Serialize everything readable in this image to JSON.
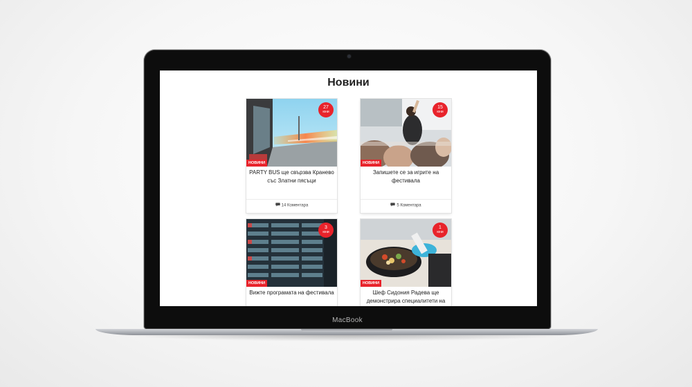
{
  "device": {
    "brand": "MacBook"
  },
  "page": {
    "title": "Новини"
  },
  "news": [
    {
      "day": "27",
      "month": "юни",
      "category": "НОВИНИ",
      "title": "PARTY BUS ще свързва Кранево със Златни пясъци",
      "comments": "14 Коментара"
    },
    {
      "day": "15",
      "month": "юни",
      "category": "НОВИНИ",
      "title": "Запишете се за игрите на фестивала",
      "comments": "5 Коментара"
    },
    {
      "day": "3",
      "month": "юни",
      "category": "НОВИНИ",
      "title": "Вижте програмата на фестивала",
      "comments": ""
    },
    {
      "day": "1",
      "month": "юни",
      "category": "НОВИНИ",
      "title": "Шеф Сидония Радева ще демонстрира специалитети на",
      "comments": ""
    }
  ],
  "icons": {
    "comments": "comment-icon"
  },
  "colors": {
    "accent": "#e8232b",
    "screen_bg": "#ffffff",
    "bezel": "#0d0d0d"
  }
}
